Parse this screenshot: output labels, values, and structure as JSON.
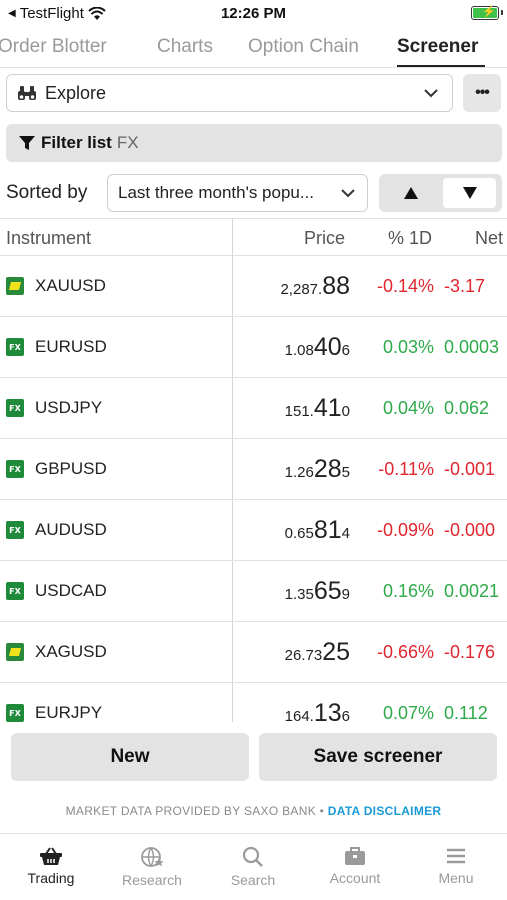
{
  "status_bar": {
    "back_label": "TestFlight",
    "time": "12:26 PM"
  },
  "tabs": [
    {
      "label": "Order Blotter",
      "active": false
    },
    {
      "label": "Charts",
      "active": false
    },
    {
      "label": "Option Chain",
      "active": false
    },
    {
      "label": "Screener",
      "active": true
    }
  ],
  "explore": {
    "label": "Explore",
    "icon": "binoculars-icon"
  },
  "filter": {
    "label": "Filter list",
    "value": "FX"
  },
  "sort": {
    "label": "Sorted by",
    "selected": "Last three month's popu...",
    "ascending": false
  },
  "table": {
    "columns": [
      "Instrument",
      "Price",
      "% 1D",
      "Net"
    ],
    "rows": [
      {
        "type": "metal",
        "name": "XAUUSD",
        "price": [
          "2,287.",
          "88",
          ""
        ],
        "pct": "-0.14%",
        "net": "-3.17",
        "dir": "neg"
      },
      {
        "type": "fx",
        "name": "EURUSD",
        "price": [
          "1.08",
          "40",
          "6"
        ],
        "pct": "0.03%",
        "net": "0.0003",
        "dir": "pos"
      },
      {
        "type": "fx",
        "name": "USDJPY",
        "price": [
          "151.",
          "41",
          "0"
        ],
        "pct": "0.04%",
        "net": "0.062",
        "dir": "pos"
      },
      {
        "type": "fx",
        "name": "GBPUSD",
        "price": [
          "1.26",
          "28",
          "5"
        ],
        "pct": "-0.11%",
        "net": "-0.001",
        "dir": "neg"
      },
      {
        "type": "fx",
        "name": "AUDUSD",
        "price": [
          "0.65",
          "81",
          "4"
        ],
        "pct": "-0.09%",
        "net": "-0.000",
        "dir": "neg"
      },
      {
        "type": "fx",
        "name": "USDCAD",
        "price": [
          "1.35",
          "65",
          "9"
        ],
        "pct": "0.16%",
        "net": "0.0021",
        "dir": "pos"
      },
      {
        "type": "metal",
        "name": "XAGUSD",
        "price": [
          "26.73",
          "25",
          ""
        ],
        "pct": "-0.66%",
        "net": "-0.176",
        "dir": "neg"
      },
      {
        "type": "fx",
        "name": "EURJPY",
        "price": [
          "164.",
          "13",
          "6"
        ],
        "pct": "0.07%",
        "net": "0.112",
        "dir": "pos"
      }
    ]
  },
  "buttons": {
    "new": "New",
    "save": "Save screener"
  },
  "provider": {
    "text": "MARKET DATA PROVIDED BY SAXO BANK •",
    "disclaimer": "DATA DISCLAIMER"
  },
  "nav": [
    {
      "label": "Trading",
      "icon": "basket-icon",
      "active": true
    },
    {
      "label": "Research",
      "icon": "globe-star-icon",
      "active": false
    },
    {
      "label": "Search",
      "icon": "search-icon",
      "active": false
    },
    {
      "label": "Account",
      "icon": "briefcase-icon",
      "active": false
    },
    {
      "label": "Menu",
      "icon": "hamburger-icon",
      "active": false
    }
  ],
  "colors": {
    "negative": "#e0262f",
    "positive": "#2eaa4a",
    "link": "#1a9bd7",
    "fx_badge": "#1f8a3a"
  }
}
